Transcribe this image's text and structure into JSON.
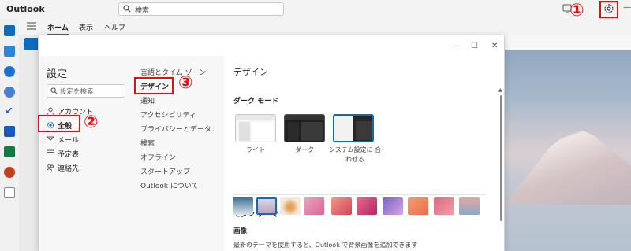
{
  "app": {
    "title": "Outlook"
  },
  "search": {
    "placeholder": "検索"
  },
  "ribbon": {
    "tabs": [
      {
        "label": "ホーム",
        "active": true
      },
      {
        "label": "表示"
      },
      {
        "label": "ヘルプ"
      }
    ]
  },
  "annotations": {
    "marker_1": "①",
    "marker_2": "②",
    "marker_3": "③",
    "color": "#e01010"
  },
  "dialog": {
    "title": "設定",
    "search_placeholder": "設定を検索",
    "controls": {
      "minimize": "—",
      "maximize": "☐",
      "close": "✕"
    },
    "nav_items": [
      {
        "label": "アカウント",
        "icon": "person-icon"
      },
      {
        "label": "全般",
        "icon": "gear-icon",
        "active": true
      },
      {
        "label": "メール",
        "icon": "mail-icon"
      },
      {
        "label": "予定表",
        "icon": "calendar-icon"
      },
      {
        "label": "連絡先",
        "icon": "people-icon"
      }
    ],
    "sub_items": [
      {
        "label": "言語とタイム ゾーン"
      },
      {
        "label": "デザイン",
        "active": true
      },
      {
        "label": "通知"
      },
      {
        "label": "アクセシビリティ"
      },
      {
        "label": "プライバシーとデータ"
      },
      {
        "label": "検索"
      },
      {
        "label": "オフライン"
      },
      {
        "label": "スタートアップ"
      },
      {
        "label": "Outlook について"
      }
    ],
    "content": {
      "title": "デザイン",
      "dark_mode_title": "ダーク モード",
      "modes": [
        {
          "label": "ライト"
        },
        {
          "label": "ダーク"
        },
        {
          "label": "システム設定に 合わせる",
          "selected": true
        }
      ],
      "modern_theme_title": "モダン テーマ",
      "image_label": "画像",
      "description": "最新のテーマを使用すると、Outlook で背景画像を追加できます"
    }
  },
  "colors": {
    "accent": "#0f6cbd",
    "annotation": "#e01010"
  }
}
